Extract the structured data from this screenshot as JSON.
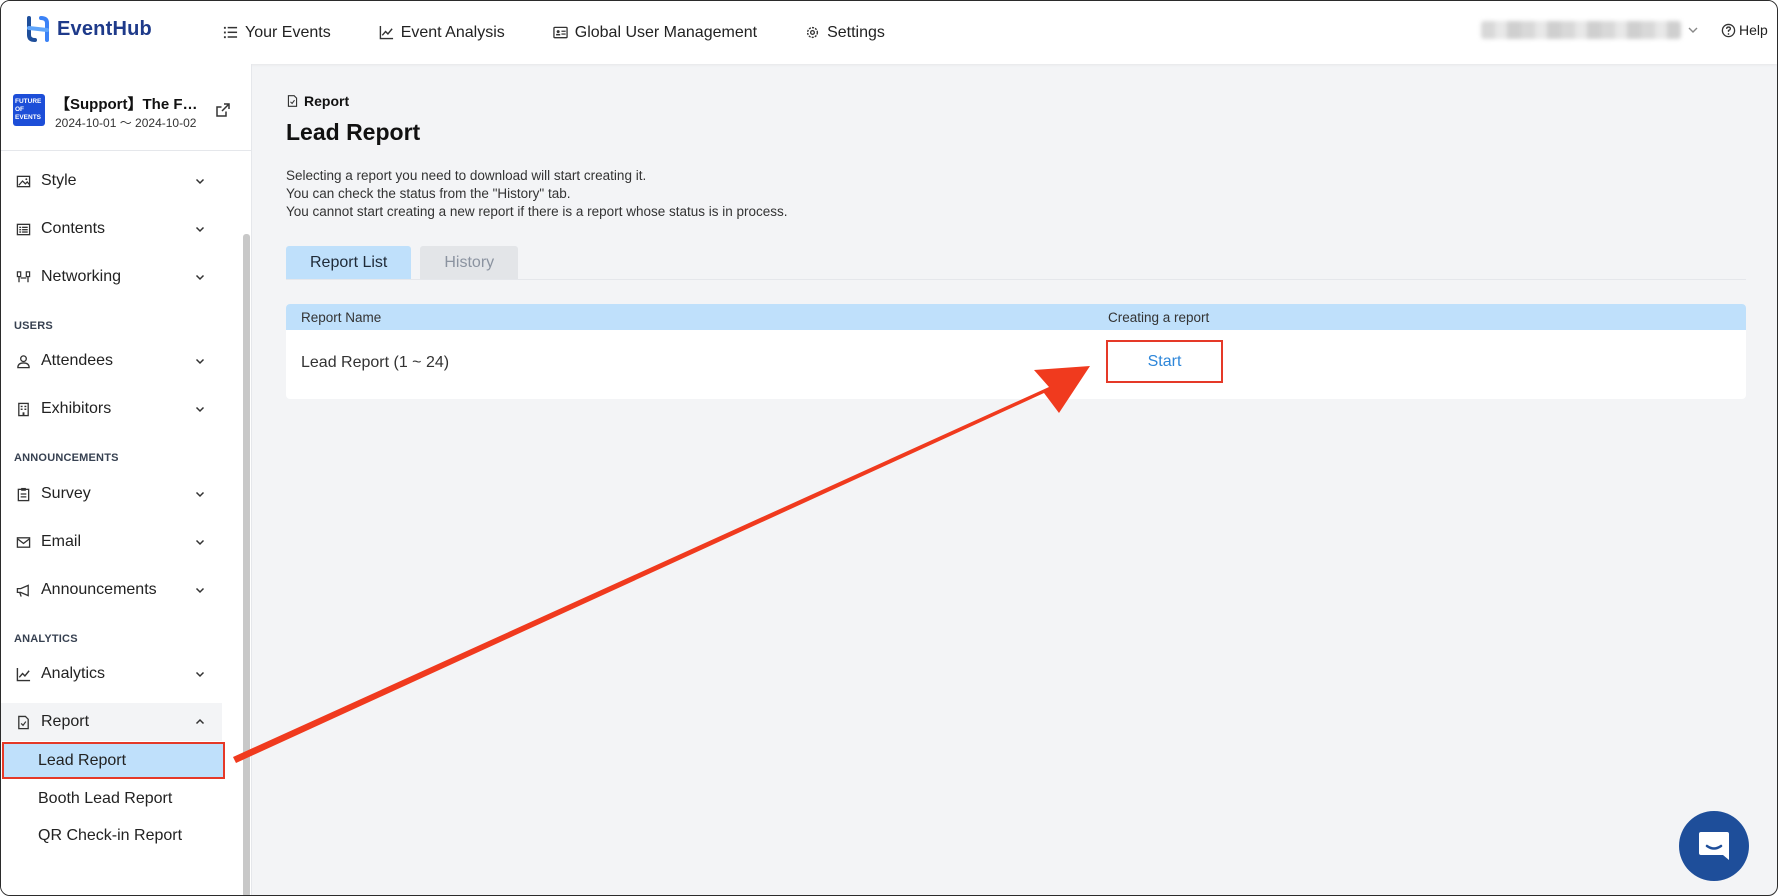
{
  "app": {
    "name": "EventHub"
  },
  "nav": {
    "items": [
      {
        "label": "Your Events",
        "icon": "list-icon"
      },
      {
        "label": "Event Analysis",
        "icon": "chart-icon"
      },
      {
        "label": "Global User Management",
        "icon": "id-card-icon"
      },
      {
        "label": "Settings",
        "icon": "gear-icon"
      }
    ],
    "help_label": "Help"
  },
  "event": {
    "title": "【Support】The F…",
    "dates": "2024-10-01 ～ 2024-10-02",
    "thumb_text": "FUTURE OF EVENTS"
  },
  "sidebar": {
    "items": [
      {
        "label": "Style",
        "icon": "image-icon"
      },
      {
        "label": "Contents",
        "icon": "list-box-icon"
      },
      {
        "label": "Networking",
        "icon": "network-icon"
      },
      {
        "label": "Attendees",
        "icon": "person-icon"
      },
      {
        "label": "Exhibitors",
        "icon": "building-icon"
      },
      {
        "label": "Survey",
        "icon": "clipboard-icon"
      },
      {
        "label": "Email",
        "icon": "mail-icon"
      },
      {
        "label": "Announcements",
        "icon": "megaphone-icon"
      },
      {
        "label": "Analytics",
        "icon": "chart-icon"
      },
      {
        "label": "Report",
        "icon": "document-icon"
      }
    ],
    "sections": {
      "users": "USERS",
      "announcements": "ANNOUNCEMENTS",
      "analytics": "ANALYTICS"
    },
    "report_sub": [
      "Lead Report",
      "Booth Lead Report",
      "QR Check-in Report"
    ]
  },
  "main": {
    "breadcrumb": "Report",
    "title": "Lead Report",
    "description": [
      "Selecting a report you need to download will start creating it.",
      "You can check the status from the \"History\" tab.",
      "You cannot start creating a new report if there is a report whose status is in process."
    ],
    "tabs": [
      "Report List",
      "History"
    ],
    "table": {
      "headers": [
        "Report Name",
        "Creating a report"
      ],
      "rows": [
        {
          "name": "Lead Report (1 ~ 24)",
          "action": "Start"
        }
      ]
    }
  },
  "colors": {
    "accent": "#bfe0fb",
    "highlight": "#e53928",
    "link": "#2d86d9",
    "chat": "#1e4e9a"
  }
}
